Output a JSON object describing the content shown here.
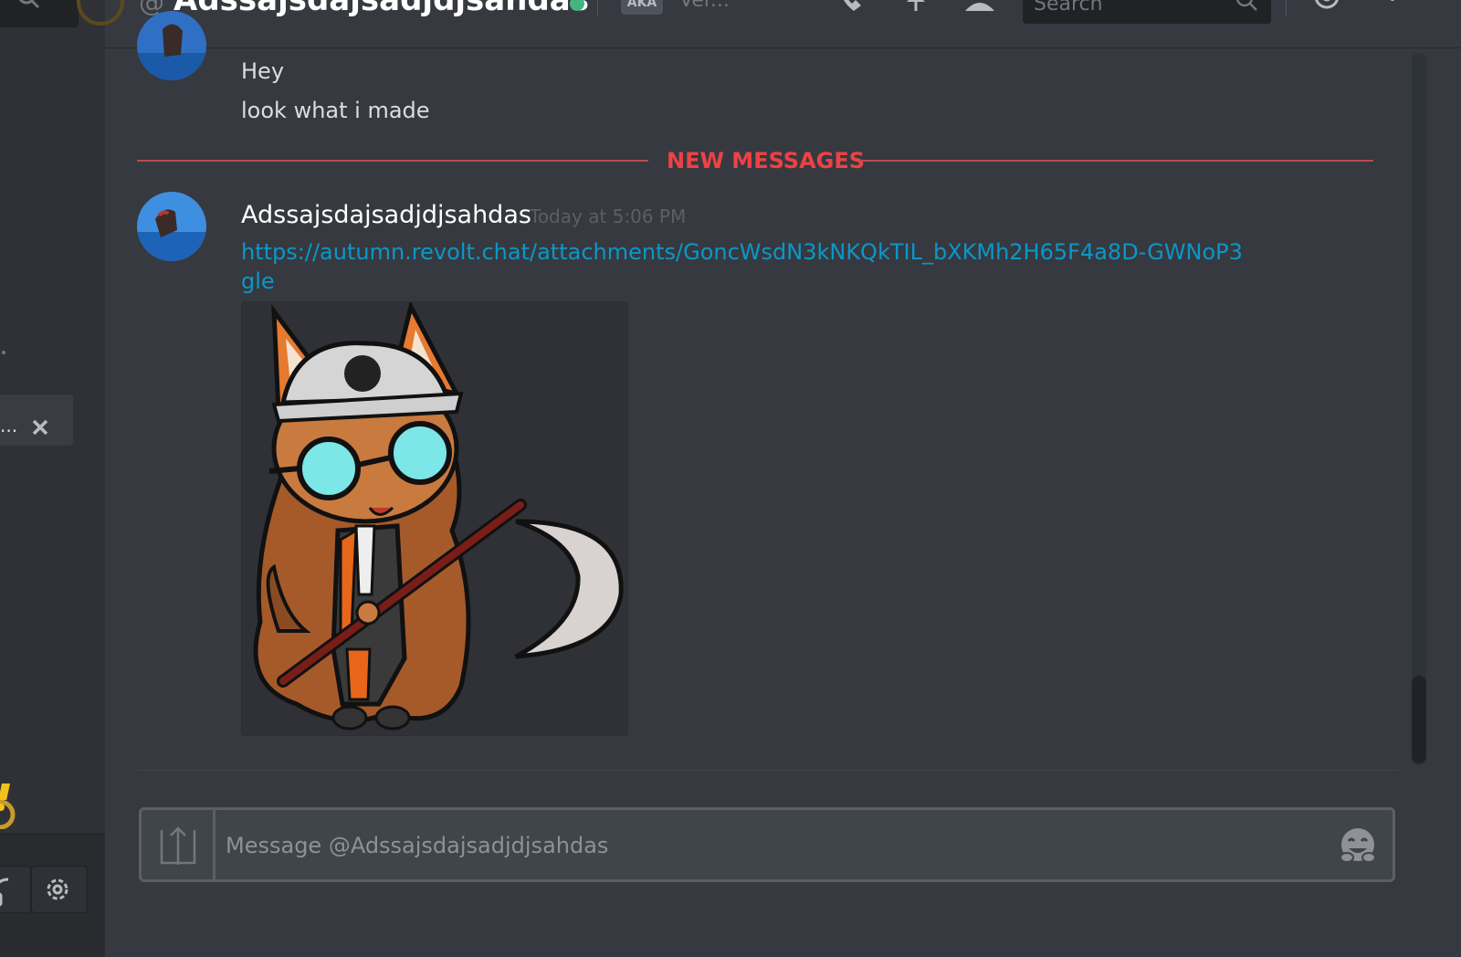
{
  "header": {
    "at_symbol": "@",
    "dm_name": "Adssajsdajsadjdjsahdas",
    "aka_badge": "AKA",
    "nickname_preview": "Ver...",
    "search_placeholder": "Search",
    "icons": [
      "phone-icon",
      "pin-icon",
      "add-friend-icon",
      "search-icon",
      "mention-icon",
      "help-icon"
    ]
  },
  "sidebar": {
    "truncated_item": "...",
    "icons": [
      "search-icon",
      "close-icon",
      "alert-icon",
      "headset-icon",
      "gear-icon"
    ]
  },
  "messages": {
    "previous": {
      "lines": [
        "Hey",
        "look what i made"
      ]
    },
    "divider_label": "NEW MESSAGES",
    "latest": {
      "author": "Adssajsdajsadjdjsahdas",
      "timestamp": "Today at 5:06 PM",
      "link": "https://autumn.revolt.chat/attachments/GoncWsdN3kNKQkTIL_bXKMh2H65F4a8D-GWNoP3gle"
    }
  },
  "composer": {
    "placeholder": "Message @Adssajsdajsadjdjsahdas",
    "value": ""
  },
  "colors": {
    "background": "#36393f",
    "sidebar": "#2f3136",
    "new_messages": "#ed4245",
    "link": "#0b97c9",
    "online": "#43b581"
  }
}
